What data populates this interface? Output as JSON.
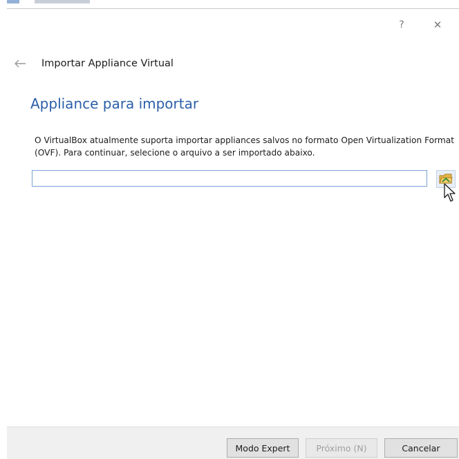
{
  "window": {
    "help_glyph": "?",
    "close_glyph": "✕"
  },
  "wizard": {
    "title": "Importar Appliance Virtual",
    "section_title": "Appliance para importar",
    "description": "O VirtualBox atualmente suporta importar appliances salvos no formato Open Virtualization Format (OVF). Para continuar, selecione o arquivo a ser importado abaixo.",
    "file_input_value": ""
  },
  "footer": {
    "expert_label": "Modo Expert",
    "next_label": "Próximo (N)",
    "cancel_label": "Cancelar"
  },
  "icons": {
    "back": "back-arrow-icon",
    "browse": "folder-icon",
    "close": "close-icon",
    "help": "help-icon"
  },
  "colors": {
    "section_title": "#2b5fa8",
    "input_border": "#7aa2d6",
    "footer_bg": "#f0f0f0",
    "disabled_text": "#a0a0a0"
  }
}
